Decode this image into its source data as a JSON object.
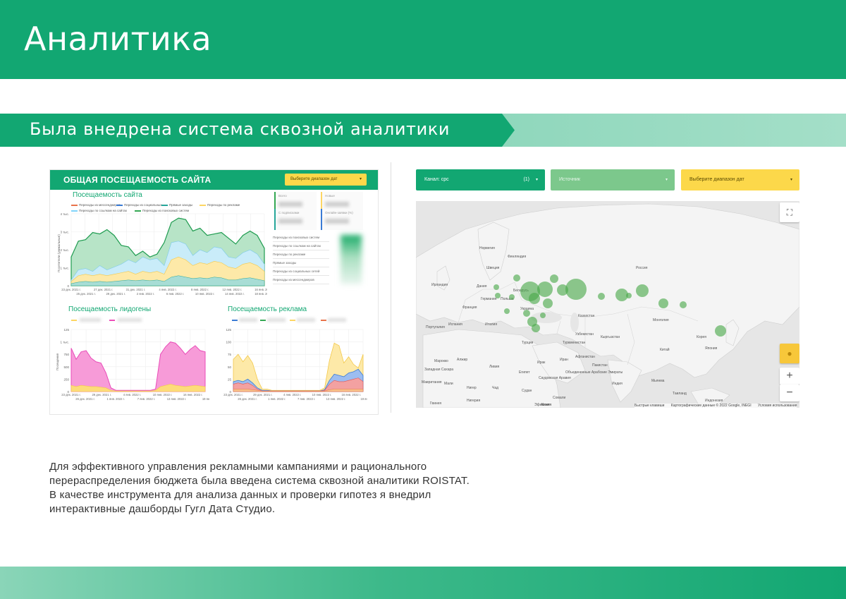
{
  "header": {
    "title": "Аналитика"
  },
  "section": {
    "subtitle": "Была внедрена система сквозной аналитики"
  },
  "dashboard_left": {
    "title": "ОБЩАЯ ПОСЕЩАЕМОСТЬ САЙТА",
    "date_button": "Выберите диапазон дат",
    "traffic": {
      "title": "Посещаемость сайта",
      "legend": [
        {
          "label": "Переходы из мессенджеров",
          "color": "#e8734a"
        },
        {
          "label": "Переходы из социальных...",
          "color": "#3a7bd5"
        },
        {
          "label": "Прямые заходы",
          "color": "#26a69a"
        },
        {
          "label": "Переходы по рекламе",
          "color": "#fdd663"
        },
        {
          "label": "Переходы по ссылкам на сайтах",
          "color": "#81d4fa"
        },
        {
          "label": "Переходы из поисковых систем",
          "color": "#34a853"
        }
      ],
      "y_ticks": [
        "4 тыс.",
        "3 тыс.",
        "2 тыс.",
        "1 тыс.",
        "0"
      ],
      "y_label": "Посетители (уникальные)",
      "x_ticks_top": [
        "23 дек. 2021 г.",
        "27 дек. 2021 г.",
        "31 дек. 2021 г.",
        "4 янв. 2022 г.",
        "8 янв. 2022 г.",
        "12 янв. 2022 г.",
        "16 янв. 2022 г."
      ],
      "x_ticks_bottom": [
        "25 дек. 2021 г.",
        "29 дек. 2021 г.",
        "2 янв. 2022 г.",
        "6 янв. 2022 г.",
        "10 янв. 2022 г.",
        "14 янв. 2022 г.",
        "18 янв. 2022 г."
      ],
      "tiles": [
        "Всего",
        "Новые",
        "С подписками",
        "Онлайн-заявки (%)"
      ],
      "table_rows": [
        "Переходы из поисковых систем",
        "Переходы по ссылкам на сайтах",
        "Переходы по рекламе",
        "Прямые заходы",
        "Переходы из социальных сетей",
        "Переходы из мессенджеров"
      ]
    },
    "leadgen": {
      "title": "Посещаемость лидогены",
      "y_ticks": [
        "125",
        "1 тыс.",
        "750",
        "500",
        "250",
        "0"
      ],
      "y_label": "Посещения",
      "x_ticks_top": [
        "23 дек. 2021 г.",
        "29 дек. 2021 г.",
        "4 янв. 2022 г.",
        "10 янв. 2022 г.",
        "16 янв. 2022 г."
      ],
      "x_ticks_bottom": [
        "26 дек. 2021 г.",
        "1 янв. 2022 г.",
        "7 янв. 2022 г.",
        "13 янв. 2022 г.",
        "19 янв."
      ]
    },
    "ads": {
      "title": "Посещаемость реклама",
      "y_ticks": [
        "125",
        "100",
        "75",
        "50",
        "25",
        "0"
      ],
      "x_ticks_top": [
        "23 дек. 2021 г.",
        "29 дек. 2021 г.",
        "4 янв. 2022 г.",
        "10 янв. 2022 г.",
        "16 янв. 2022 г."
      ],
      "x_ticks_bottom": [
        "26 дек. 2021 г.",
        "1 янв. 2022 г.",
        "7 янв. 2022 г.",
        "13 янв. 2022 г.",
        "19 янв."
      ]
    }
  },
  "dashboard_right": {
    "channel_select": {
      "label": "Канал: cpc",
      "count": "(1)",
      "color": "#12a772"
    },
    "source_select": {
      "label": "Источник",
      "color": "#7cc88c"
    },
    "date_select": {
      "label": "Выберите диапазон дат",
      "color": "#fcd84a"
    },
    "map": {
      "zoom_in": "+",
      "zoom_out": "−",
      "fullscreen": "⛶",
      "footer_shortcuts": "Быстрые клавиши",
      "footer_data": "Картографические данные © 2022 Google, INEGI",
      "footer_terms": "Условия использования",
      "labels": [
        "Норвегия",
        "Финляндия",
        "Швеция",
        "Россия",
        "Дания",
        "Германия",
        "Польша",
        "Беларусь",
        "Украина",
        "Франция",
        "Испания",
        "Португалия",
        "Италия",
        "Турция",
        "Казахстан",
        "Монголия",
        "Китай",
        "Ирак",
        "Иран",
        "Марокко",
        "Алжир",
        "Ливия",
        "Египет",
        "Мавритания",
        "Мали",
        "Нигер",
        "Чад",
        "Судан",
        "Саудовская Аравия",
        "Индия",
        "Пакистан",
        "Афганистан",
        "Туркменистан",
        "Узбекистан",
        "Япония",
        "Таиланд",
        "Мьянма",
        "Кыргызстан",
        "Западная Сахара",
        "Эфиопия",
        "Нигерия",
        "Сомали",
        "Кения",
        "Индонезия",
        "Гвинея",
        "Объединенные Арабские Эмираты",
        "Корея",
        "Кения",
        "Ирландия"
      ]
    }
  },
  "description": {
    "p1": "Для эффективного управления рекламными кампаниями и рационального перераспределения бюджета была введена система сквозной аналитики ROISTAT.",
    "p2": "В качестве инструмента для анализа данных и проверки гипотез я внедрил интерактивные дашборды Гугл Дата Студио."
  }
}
